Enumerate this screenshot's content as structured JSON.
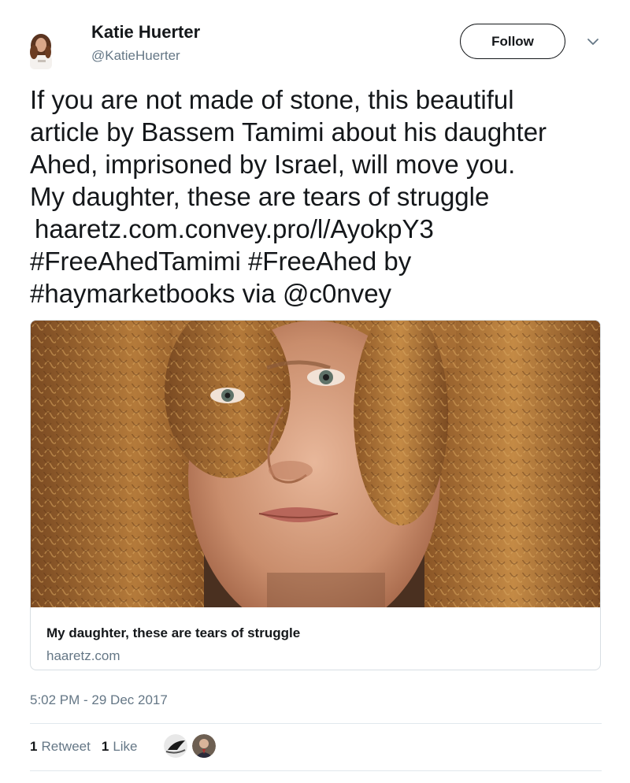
{
  "author": {
    "name": "Katie Huerter",
    "handle": "@KatieHuerter"
  },
  "header": {
    "follow_label": "Follow",
    "menu_icon": "chevron-down-icon"
  },
  "tweet": {
    "lines": [
      "If you are not made of stone, this beautiful",
      "article by Bassem Tamimi about his daughter",
      "Ahed, imprisoned by Israel, will move you.",
      "My daughter, these are tears of struggle",
      "haaretz.com.convey.pro/l/AyokpY3",
      "#FreeAhedTamimi #FreeAhed by",
      "#haymarketbooks via @c0nvey"
    ]
  },
  "card": {
    "title": "My daughter, these are tears of struggle",
    "domain": "haaretz.com"
  },
  "meta": {
    "timestamp": "5:02 PM - 29 Dec 2017"
  },
  "stats": {
    "retweets_count": "1",
    "retweets_label": "Retweet",
    "likes_count": "1",
    "likes_label": "Like"
  },
  "colors": {
    "text": "#14171a",
    "secondary": "#657786",
    "border": "#e1e8ed"
  }
}
